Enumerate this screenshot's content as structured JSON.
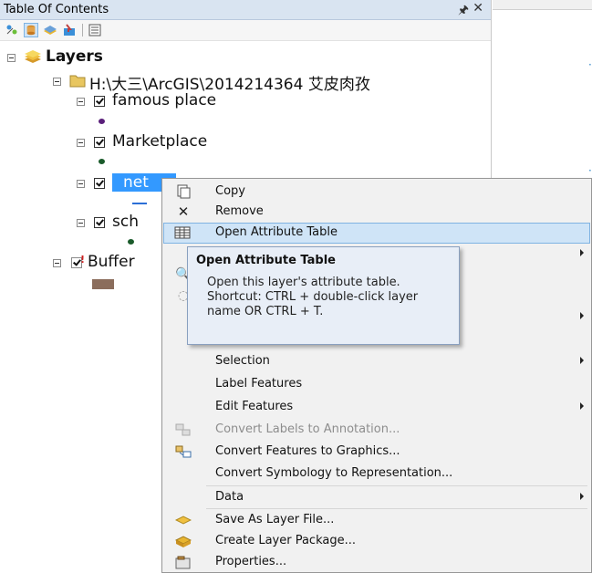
{
  "toc": {
    "title": "Table Of Contents",
    "pin_glyph": "↕",
    "close_glyph": "×",
    "toolbar_icons": [
      "list-by-drawing-order-icon",
      "list-by-source-icon",
      "list-by-visibility-icon",
      "list-by-selection-icon",
      "options-icon"
    ],
    "tree": {
      "root_label": "Layers",
      "folder_label": "H:\\大三\\ArcGIS\\2014214364 艾皮肉孜",
      "layers": [
        {
          "name": "famous place",
          "symbol_color": "#5a1f7a"
        },
        {
          "name": "Marketplace",
          "symbol_color": "#1a5a2a"
        },
        {
          "name": "net",
          "symbol_color": "#2b6fd6"
        },
        {
          "name": "sch",
          "symbol_color": "#1a5a2a"
        },
        {
          "name": "Buffer",
          "symbol_color": "#8b6d5c"
        }
      ]
    }
  },
  "context_menu": {
    "items": [
      {
        "label": "Copy",
        "icon": "copy-icon",
        "glyph": "⎙"
      },
      {
        "label": "Remove",
        "icon": "remove-icon",
        "glyph": "✖"
      },
      {
        "label": "Open Attribute Table",
        "icon": "table-icon",
        "glyph": "▦",
        "highlight": true
      },
      {
        "label": "Selection"
      },
      {
        "label": "Label Features"
      },
      {
        "label": "Edit Features"
      },
      {
        "label": "Convert Labels to Annotation...",
        "icon": "convert-labels-icon",
        "disabled": true
      },
      {
        "label": "Convert Features to Graphics...",
        "icon": "convert-features-icon"
      },
      {
        "label": "Convert Symbology to Representation..."
      },
      {
        "label": "Data"
      },
      {
        "label": "Save As Layer File...",
        "icon": "layer-file-icon"
      },
      {
        "label": "Create Layer Package...",
        "icon": "layer-package-icon"
      },
      {
        "label": "Properties...",
        "icon": "properties-icon"
      }
    ]
  },
  "tooltip": {
    "title": "Open Attribute Table",
    "body": "Open this layer's attribute table. Shortcut: CTRL + double-click layer name OR CTRL + T."
  },
  "colors": {
    "title_bar": "#d9e4f1",
    "highlight": "#cfe4f7",
    "selected_layer": "#3399ff"
  }
}
